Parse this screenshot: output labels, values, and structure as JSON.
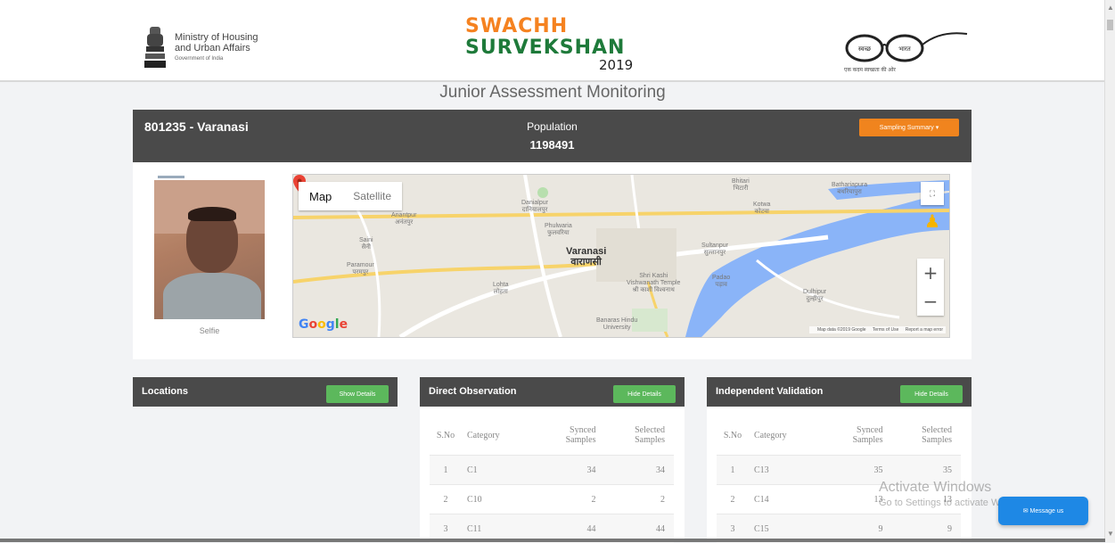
{
  "header": {
    "ministry_line1": "Ministry of Housing",
    "ministry_line2": "and Urban Affairs",
    "ministry_line3": "Government of India",
    "brand_line1": "SWACHH",
    "brand_line2": "SURVEKSHAN",
    "brand_year": "2019",
    "brand_colors": {
      "orange": "#f58220",
      "green": "#1e7a3a"
    },
    "sb_logo_text_left": "स्वच्छ",
    "sb_logo_text_right": "भारत",
    "sb_tagline": "एक कदम स्वच्छता की ओर"
  },
  "page_title": "Junior Assessment Monitoring",
  "city": {
    "name": "801235 - Varanasi",
    "population_label": "Population",
    "population_value": "1198491",
    "sampling_button": "Sampling Summary ▾"
  },
  "selfie": {
    "label": "Selfie"
  },
  "map": {
    "type_map": "Map",
    "type_satellite": "Satellite",
    "zoom_in": "+",
    "zoom_out": "−",
    "google_letters": [
      "G",
      "o",
      "o",
      "g",
      "l",
      "e"
    ],
    "google_colors": [
      "#4285f4",
      "#ea4335",
      "#fbbc05",
      "#4285f4",
      "#34a853",
      "#ea4335"
    ],
    "attribution": "Map data ©2019 Google",
    "terms": "Terms of Use",
    "report": "Report a map error",
    "labels": {
      "bhitari": "Bhitari",
      "bhitari_hi": "भिटारी",
      "bathariapura": "Bathariapura",
      "bathariapura_hi": "बथरियापुरा",
      "danialpur": "Danialpur",
      "danialpur_hi": "दानियालपुर",
      "kotwa": "Kotwa",
      "kotwa_hi": "कोटवा",
      "anantpur": "Anantpur",
      "anantpur_hi": "अनंतपुर",
      "phulwaria": "Phulwaria",
      "phulwaria_hi": "फुलवरिया",
      "saini": "Saini",
      "saini_hi": "सैनी",
      "varanasi": "Varanasi",
      "varanasi_hi": "वाराणसी",
      "sultanpur": "Sultanpur",
      "sultanpur_hi": "सुल्तानपुर",
      "paramour": "Paramour",
      "paramour_hi": "परमपुर",
      "lohta": "Lohta",
      "lohta_hi": "लोहता",
      "temple": "Shri Kashi\nVishwanath Temple",
      "temple_hi": "श्री काशी विश्वनाथ",
      "padao": "Padao",
      "padao_hi": "पड़ाव",
      "dulhipur": "Dulhipur",
      "dulhipur_hi": "दुल्हीपुर",
      "bhu": "Banaras Hindu\nUniversity"
    }
  },
  "cards": [
    {
      "title": "Locations",
      "button": "Show Details"
    },
    {
      "title": "Direct Observation",
      "button": "Hide Details",
      "headers": {
        "sno": "S.No",
        "category": "Category",
        "synced": "Synced Samples",
        "selected": "Selected Samples"
      },
      "rows": [
        {
          "sno": "1",
          "category": "C1",
          "synced": "34",
          "selected": "34"
        },
        {
          "sno": "2",
          "category": "C10",
          "synced": "2",
          "selected": "2"
        },
        {
          "sno": "3",
          "category": "C11",
          "synced": "44",
          "selected": "44"
        }
      ]
    },
    {
      "title": "Independent Validation",
      "button": "Hide Details",
      "headers": {
        "sno": "S.No",
        "category": "Category",
        "synced": "Synced Samples",
        "selected": "Selected Samples"
      },
      "rows": [
        {
          "sno": "1",
          "category": "C13",
          "synced": "35",
          "selected": "35"
        },
        {
          "sno": "2",
          "category": "C14",
          "synced": "13",
          "selected": "13"
        },
        {
          "sno": "3",
          "category": "C15",
          "synced": "9",
          "selected": "9"
        }
      ]
    }
  ],
  "watermark": {
    "line1": "Activate Windows",
    "line2": "Go to Settings to activate Windows."
  },
  "chat": {
    "label": "✉ Message us"
  }
}
